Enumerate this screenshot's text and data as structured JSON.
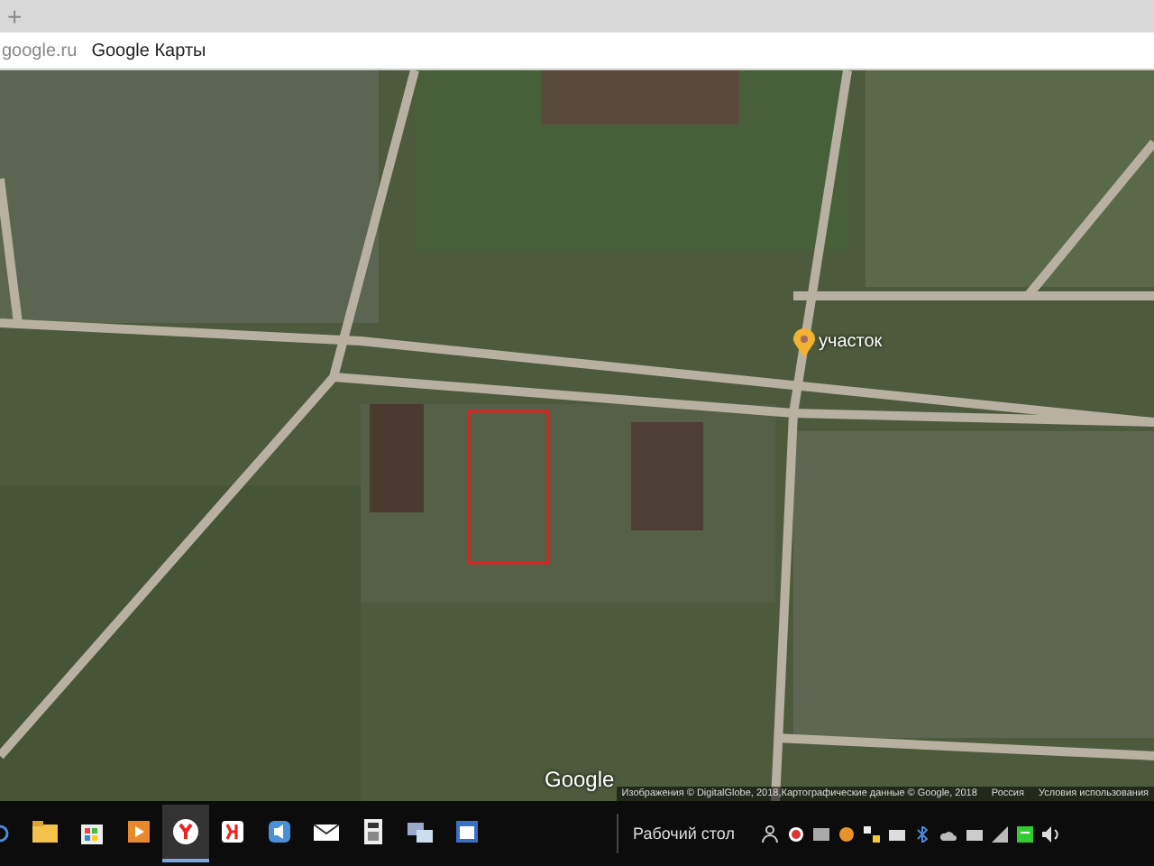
{
  "browser": {
    "new_tab": "+",
    "address": {
      "domain": "google.ru",
      "title": "Google Карты"
    }
  },
  "map": {
    "pin_label": "участок",
    "logo": "Google",
    "attribution": "Изображения © DigitalGlobe, 2018,Картографические данные © Google, 2018",
    "region": "Россия",
    "terms": "Условия использования"
  },
  "taskbar": {
    "apps": [
      {
        "kind": "folder",
        "selected": false
      },
      {
        "kind": "store",
        "selected": false
      },
      {
        "kind": "media",
        "selected": false
      },
      {
        "kind": "browser",
        "selected": true
      },
      {
        "kind": "yandex",
        "selected": false
      },
      {
        "kind": "speaker",
        "selected": false
      },
      {
        "kind": "mail",
        "selected": false
      },
      {
        "kind": "calculator",
        "selected": false
      },
      {
        "kind": "network",
        "selected": false
      },
      {
        "kind": "window",
        "selected": false
      }
    ],
    "desktop_label": "Рабочий стол"
  }
}
